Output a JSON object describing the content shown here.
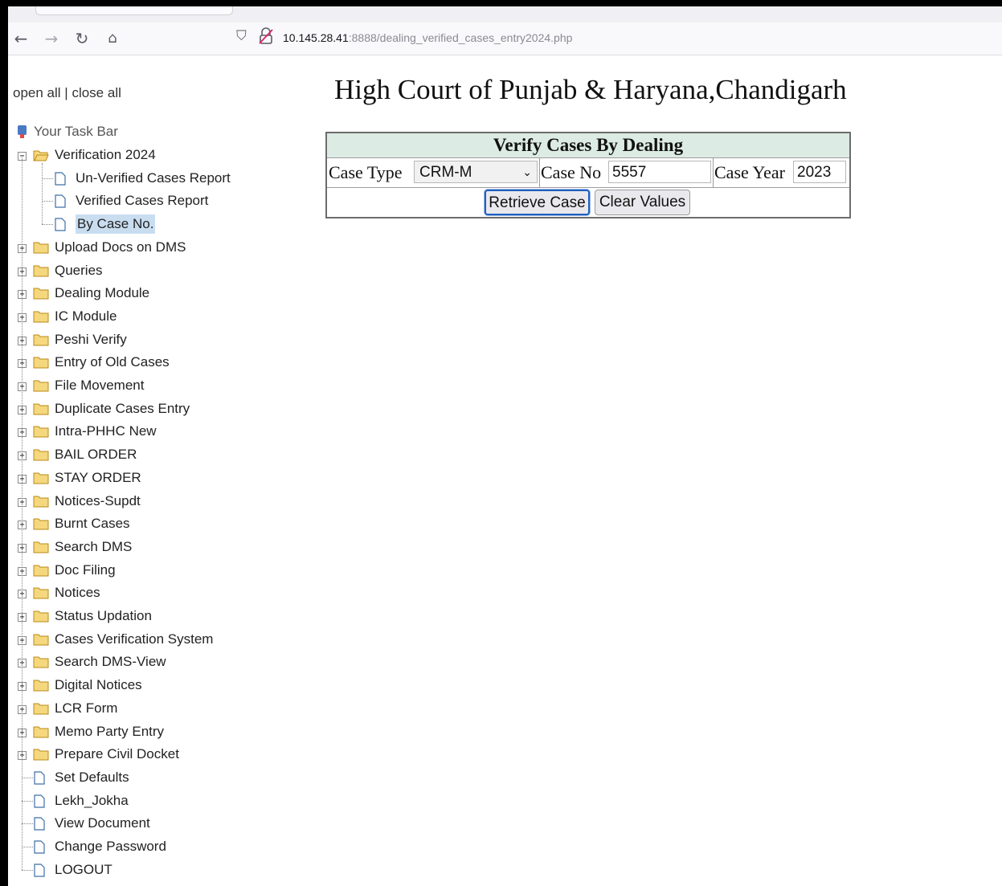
{
  "browser": {
    "url_host": "10.145.28.41",
    "url_path": ":8888/dealing_verified_cases_entry2024.php",
    "icons": {
      "back": "back-arrow-icon",
      "forward": "forward-arrow-icon",
      "reload": "reload-icon",
      "home": "home-icon",
      "shield": "shield-icon",
      "lock": "insecure-lock-icon"
    }
  },
  "sidebar": {
    "open_all": "open all",
    "separator": "|",
    "close_all": "close all",
    "root_label": "Your Task Bar",
    "verification_folder": "Verification 2024",
    "verification_children": [
      "Un-Verified Cases Report",
      "Verified Cases Report",
      "By Case No."
    ],
    "selected_item": "By Case No.",
    "folders": [
      "Upload Docs on DMS",
      "Queries",
      "Dealing Module",
      "IC Module",
      "Peshi Verify",
      "Entry of Old Cases",
      "File Movement",
      "Duplicate Cases Entry",
      "Intra-PHHC New",
      "BAIL ORDER",
      "STAY ORDER",
      "Notices-Supdt",
      "Burnt Cases",
      "Search DMS",
      "Doc Filing",
      "Notices",
      "Status Updation",
      "Cases Verification System",
      "Search DMS-View",
      "Digital Notices",
      "LCR Form",
      "Memo Party Entry",
      "Prepare Civil Docket"
    ],
    "pages": [
      "Set Defaults",
      "Lekh_Jokha",
      "View Document",
      "Change Password",
      "LOGOUT"
    ]
  },
  "main": {
    "title": "High Court of Punjab & Haryana,Chandigarh",
    "form": {
      "heading": "Verify Cases By Dealing",
      "case_type_label": "Case Type",
      "case_type_value": "CRM-M",
      "case_no_label": "Case No",
      "case_no_value": "5557",
      "case_year_label": "Case Year",
      "case_year_value": "2023",
      "retrieve_label": "Retrieve Case",
      "clear_label": "Clear Values"
    }
  },
  "colors": {
    "form_header_bg": "#dcebe4",
    "selected_bg": "#c9ddf0",
    "folder_fill": "#f5d77e",
    "focus_ring": "#1f5fbf"
  }
}
